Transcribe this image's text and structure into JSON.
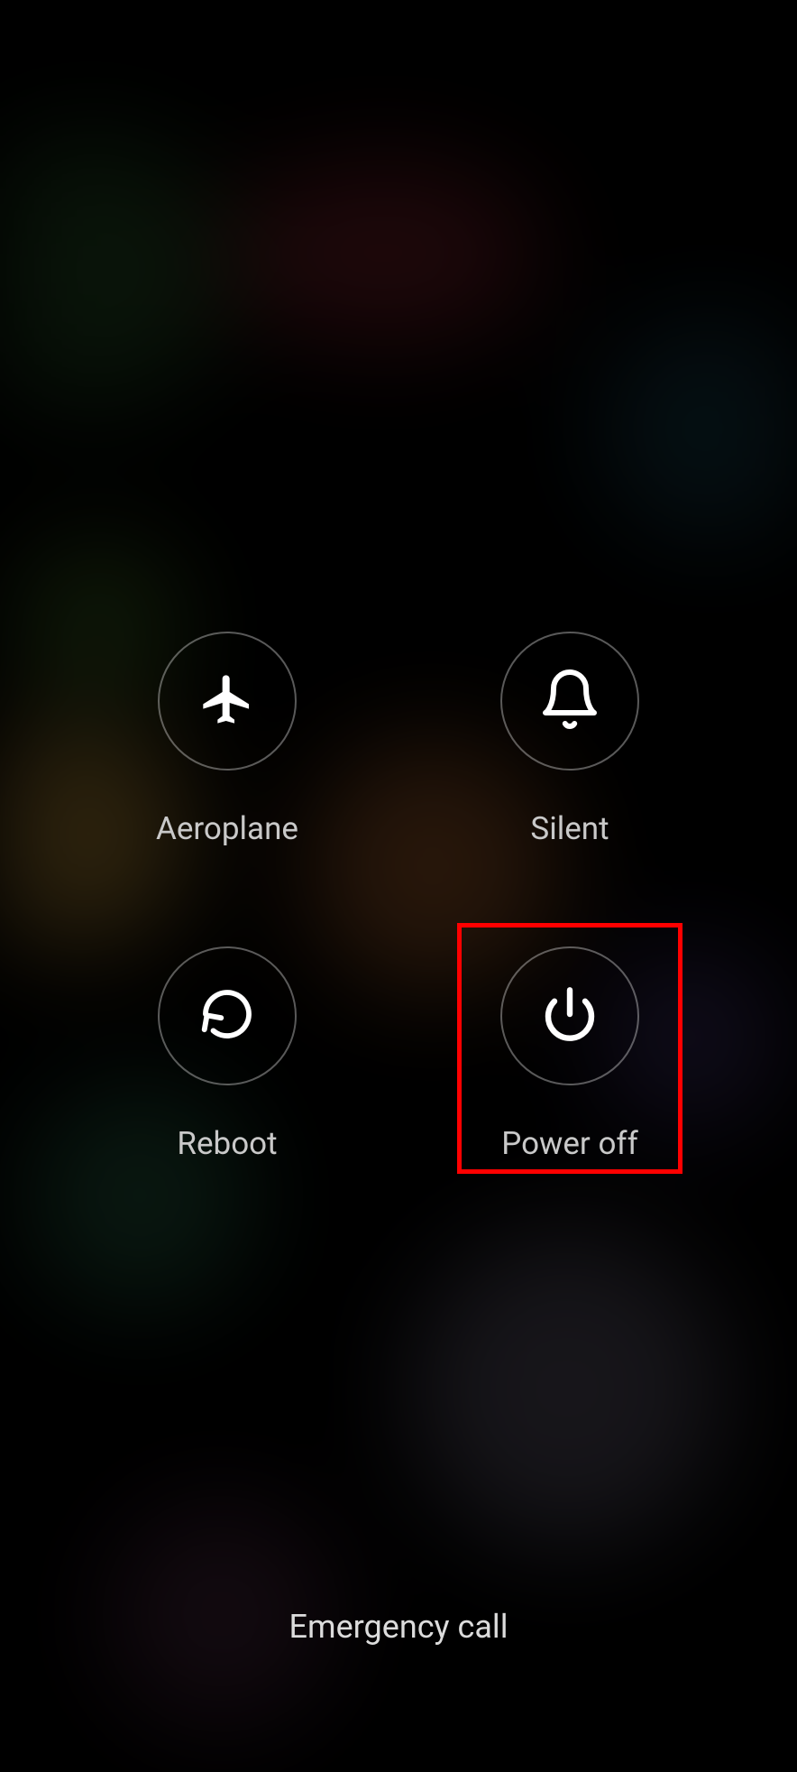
{
  "power_menu": {
    "options": {
      "aeroplane": {
        "label": "Aeroplane",
        "icon": "airplane-icon"
      },
      "silent": {
        "label": "Silent",
        "icon": "bell-icon"
      },
      "reboot": {
        "label": "Reboot",
        "icon": "restart-icon"
      },
      "power_off": {
        "label": "Power off",
        "icon": "power-icon",
        "highlighted": true
      }
    },
    "emergency_label": "Emergency call"
  }
}
